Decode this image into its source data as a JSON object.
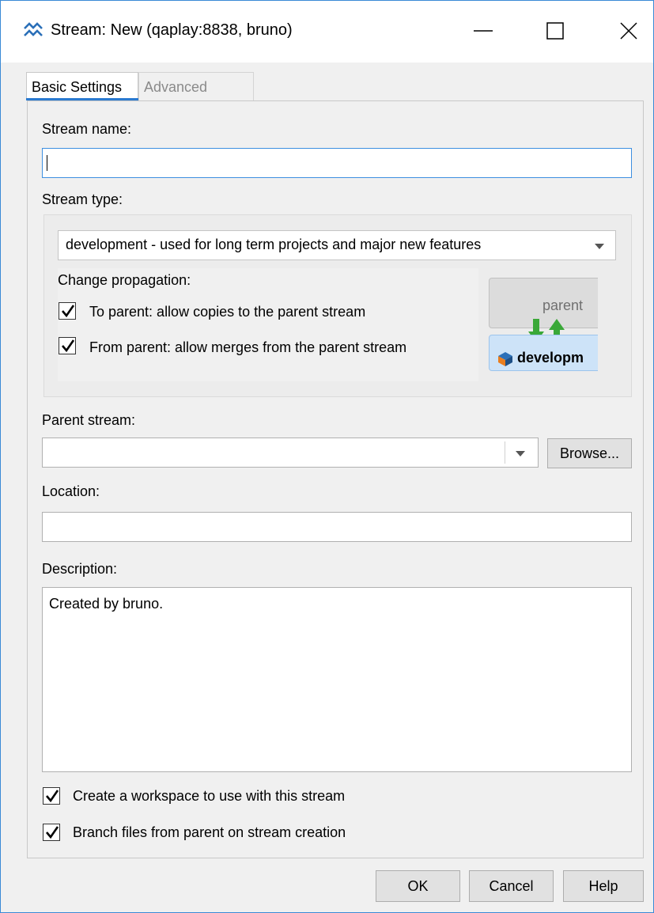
{
  "window": {
    "title": "Stream: New (qaplay:8838,  bruno)",
    "icons": {
      "app": "stream-icon",
      "minimize": "minimize-icon",
      "maximize": "maximize-icon",
      "close": "close-icon"
    }
  },
  "tabs": [
    {
      "label": "Basic Settings",
      "active": true
    },
    {
      "label": "Advanced",
      "active": false
    }
  ],
  "stream_name": {
    "label": "Stream name:",
    "value": ""
  },
  "stream_type": {
    "label": "Stream type:",
    "selected": "development - used for long term projects and major new features",
    "propagation_label": "Change propagation:",
    "to_parent": {
      "label": "To parent: allow copies to the parent stream",
      "checked": true
    },
    "from_parent": {
      "label": "From parent: allow merges from the parent stream",
      "checked": true
    },
    "diagram": {
      "parent_label": "parent",
      "dev_label": "developm"
    }
  },
  "parent_stream": {
    "label": "Parent stream:",
    "value": "",
    "browse_label": "Browse..."
  },
  "location": {
    "label": "Location:",
    "value": ""
  },
  "description": {
    "label": "Description:",
    "value": "Created by bruno."
  },
  "options": {
    "create_workspace": {
      "label": "Create a workspace to use with this stream",
      "checked": true
    },
    "branch_files": {
      "label": "Branch files from parent on stream creation",
      "checked": true
    }
  },
  "buttons": {
    "ok": "OK",
    "cancel": "Cancel",
    "help": "Help"
  },
  "colors": {
    "accent": "#2a7ad0",
    "arrow_green": "#3aa838"
  }
}
